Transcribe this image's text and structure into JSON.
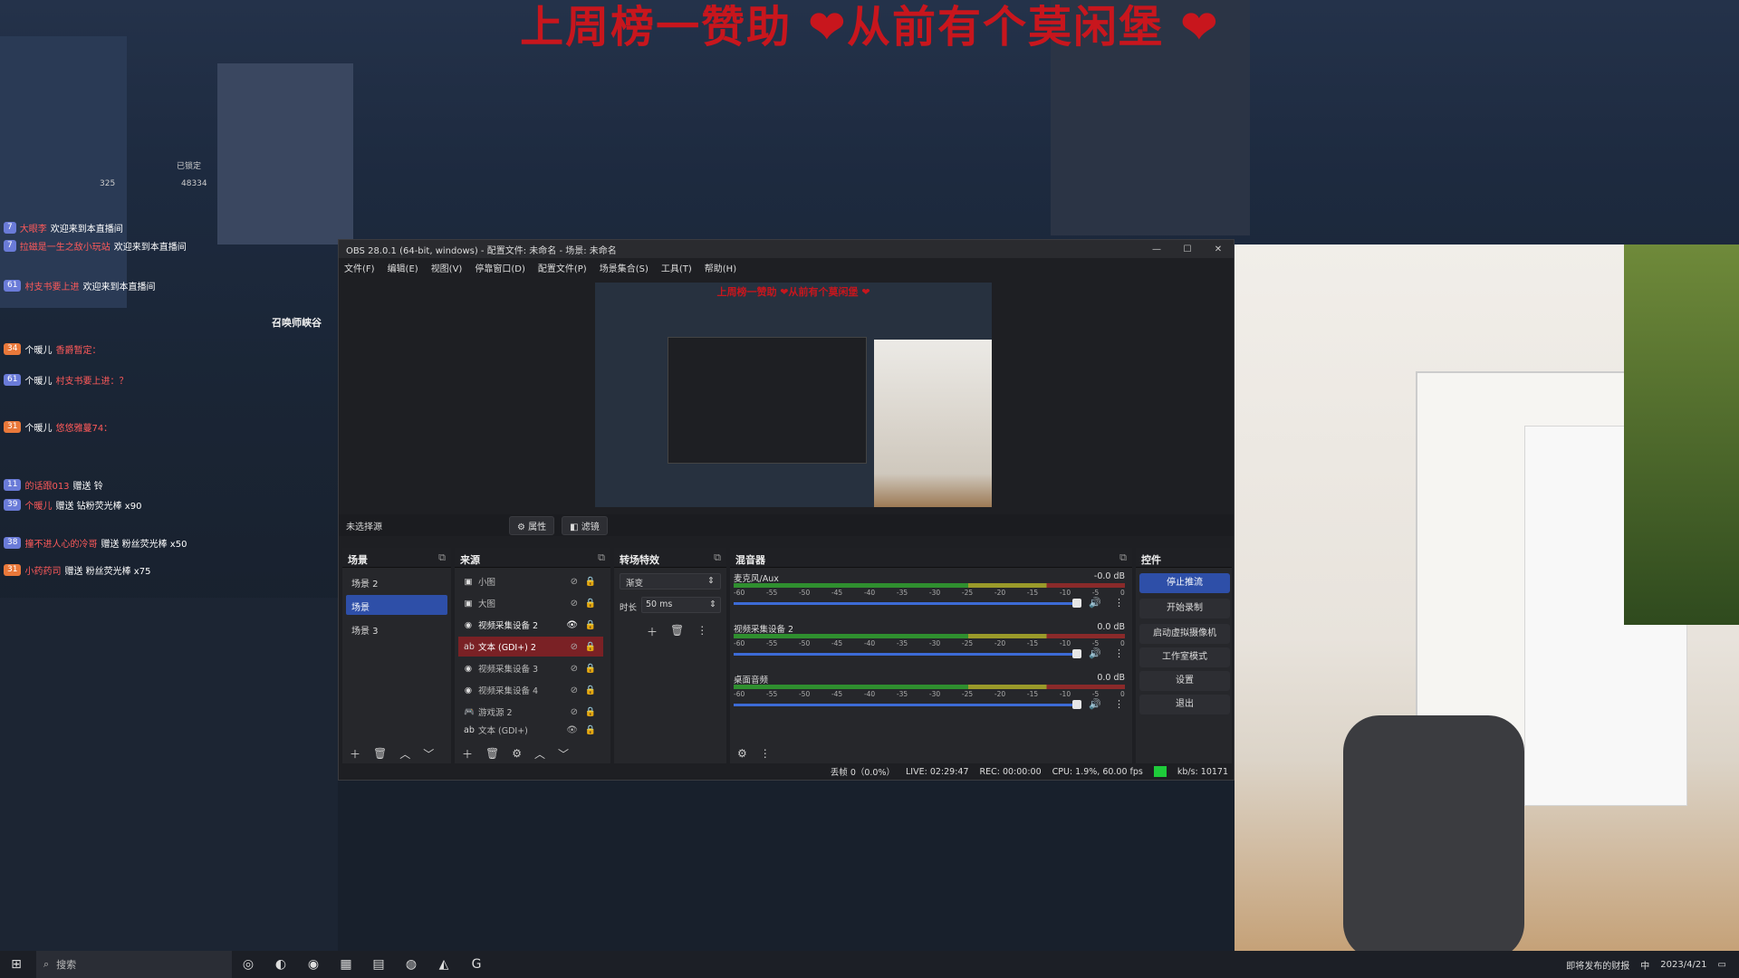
{
  "banner": {
    "text": "上周榜一赞助 ❤从前有个莫闲堡 ❤"
  },
  "stream_overlay": {
    "stats": {
      "viewers": "325",
      "likes": "48334",
      "pinned": "已锁定"
    },
    "chat": [
      {
        "level": "7",
        "name": "大眼李",
        "msg": "欢迎来到本直播间",
        "highlight": false
      },
      {
        "level": "7",
        "name": "拉磁是一生之敌小玩站",
        "msg": "欢迎来到本直播间",
        "highlight": false
      },
      {
        "level": "61",
        "name": "村支书要上进",
        "msg": "欢迎来到本直播间",
        "highlight": false
      },
      {
        "level": "34",
        "name": "个暖儿",
        "msg": "香爵暂定：",
        "highlight": true
      },
      {
        "level": "61",
        "name": "个暖儿",
        "msg": "村支书要上进：？",
        "highlight": false
      },
      {
        "level": "31",
        "name": "个暖儿",
        "msg": "悠悠雅蔓74：",
        "highlight": true
      },
      {
        "level": "11",
        "name": "的话跟013",
        "msg": "赠送 铃",
        "highlight": false
      },
      {
        "level": "39",
        "name": "个暖儿",
        "msg": "赠送 钻粉荧光棒 x90",
        "highlight": false
      },
      {
        "level": "38",
        "name": "撞不进人心的冷哥",
        "msg": "赠送 粉丝荧光棒 x50",
        "highlight": false
      },
      {
        "level": "31",
        "name": "小药药司",
        "msg": "赠送 粉丝荧光棒 x75",
        "highlight": false
      }
    ],
    "summoner_label": "召唤师峡谷"
  },
  "obs": {
    "title": "OBS 28.0.1 (64-bit, windows) - 配置文件: 未命名 - 场景: 未命名",
    "menu": [
      "文件(F)",
      "编辑(E)",
      "视图(V)",
      "停靠窗口(D)",
      "配置文件(P)",
      "场景集合(S)",
      "工具(T)",
      "帮助(H)"
    ],
    "preview_title": "上周榜一赞助 ❤从前有个莫闲堡 ❤",
    "status_row": {
      "no_source": "未选择源",
      "properties": "属性",
      "filters": "滤镜"
    },
    "scenes": {
      "title": "场景",
      "items": [
        "场景 2",
        "场景",
        "场景 3"
      ],
      "selected_index": 1
    },
    "sources": {
      "title": "来源",
      "items": [
        {
          "icon": "image-icon",
          "label": "小图",
          "visible": false
        },
        {
          "icon": "image-icon",
          "label": "大图",
          "visible": false
        },
        {
          "icon": "camera-icon",
          "label": "视频采集设备 2",
          "visible": true
        },
        {
          "icon": "text-icon",
          "label": "文本 (GDI+) 2",
          "visible": false,
          "selected": true
        },
        {
          "icon": "camera-icon",
          "label": "视频采集设备 3",
          "visible": false
        },
        {
          "icon": "camera-icon",
          "label": "视频采集设备 4",
          "visible": false
        },
        {
          "icon": "gamepad-icon",
          "label": "游戏源 2",
          "visible": false
        },
        {
          "icon": "text-icon",
          "label": "文本 (GDI+)",
          "visible": true
        }
      ]
    },
    "transitions": {
      "title": "转场特效",
      "selected": "渐变",
      "duration_label": "时长",
      "duration_value": "50 ms"
    },
    "mixer": {
      "title": "混音器",
      "ticks": [
        "-60",
        "-55",
        "-50",
        "-45",
        "-40",
        "-35",
        "-30",
        "-25",
        "-20",
        "-15",
        "-10",
        "-5",
        "0"
      ],
      "channels": [
        {
          "name": "麦克风/Aux",
          "db": "-0.0 dB"
        },
        {
          "name": "视频采集设备 2",
          "db": "0.0 dB"
        },
        {
          "name": "桌面音频",
          "db": "0.0 dB"
        }
      ]
    },
    "controls": {
      "title": "控件",
      "stop_stream": "停止推流",
      "start_record": "开始录制",
      "virtual_cam": "启动虚拟摄像机",
      "studio_mode": "工作室模式",
      "settings": "设置",
      "exit": "退出"
    },
    "statusbar": {
      "dropped": "丢帧 0（0.0%）",
      "live": "LIVE: 02:29:47",
      "rec": "REC: 00:00:00",
      "cpu": "CPU: 1.9%, 60.00 fps",
      "kbs": "kb/s: 10171"
    }
  },
  "taskbar": {
    "search_placeholder": "搜索",
    "notification": "即将发布的财报",
    "date": "2023/4/21",
    "ime": "中"
  },
  "colors": {
    "accent_blue": "#2e4fa8",
    "source_selected": "#7a2125",
    "banner_red": "#c8161d",
    "live_green": "#1ecb3a"
  }
}
